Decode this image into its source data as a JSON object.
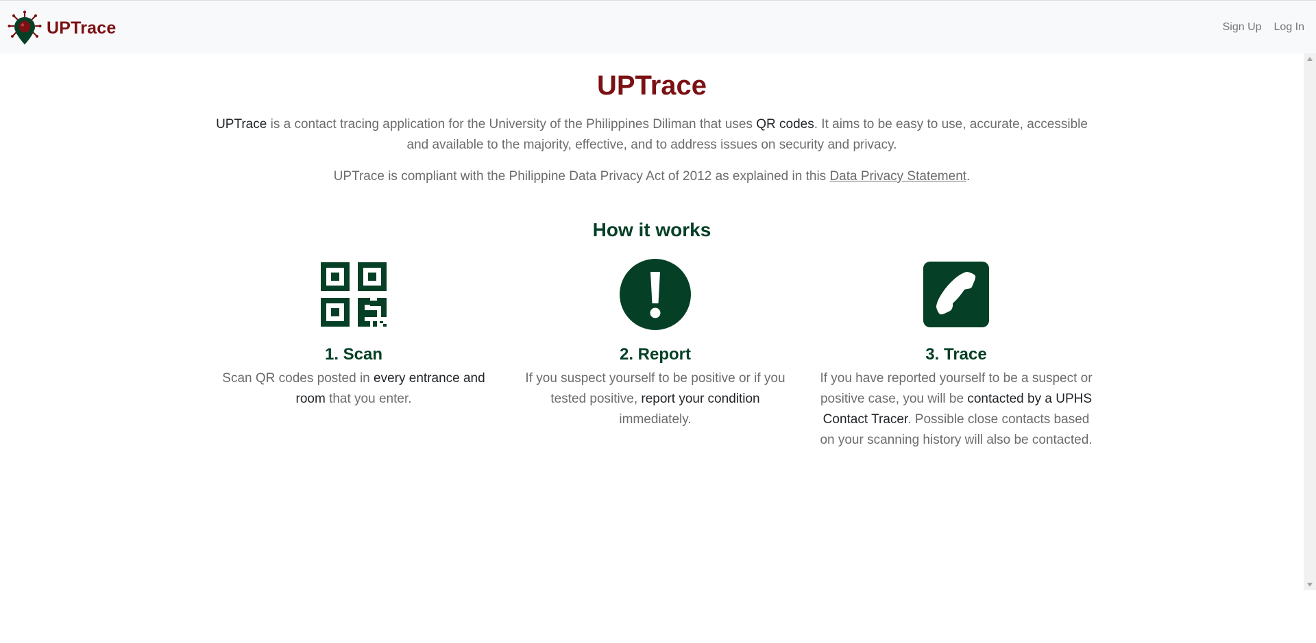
{
  "colors": {
    "brand_maroon": "#7b1113",
    "brand_green": "#054026",
    "muted_text": "#6c6c6c"
  },
  "navbar": {
    "brand": "UPTrace",
    "logo_icon": "location-pin-virus-icon",
    "links": [
      {
        "label": "Sign Up"
      },
      {
        "label": "Log In"
      }
    ]
  },
  "main": {
    "title": "UPTrace",
    "intro": {
      "app_name": "UPTrace",
      "text_a": " is a contact tracing application for the University of the Philippines Diliman that uses ",
      "qr": "QR codes",
      "text_b": ". It aims to be easy to use, accurate, accessible and available to the majority, effective, and to address issues on security and privacy."
    },
    "privacy": {
      "text": "UPTrace is compliant with the Philippine Data Privacy Act of 2012 as explained in this ",
      "link_label": "Data Privacy Statement",
      "end": "."
    },
    "how_it_works": {
      "heading": "How it works",
      "steps": [
        {
          "icon": "qr-code-icon",
          "title": "1. Scan",
          "desc_a": "Scan QR codes posted in ",
          "desc_strong": "every entrance and room",
          "desc_b": " that you enter."
        },
        {
          "icon": "exclamation-circle-icon",
          "title": "2. Report",
          "desc_a": "If you suspect yourself to be positive or if you tested positive, ",
          "desc_strong": "report your condition",
          "desc_b": " immediately."
        },
        {
          "icon": "phone-square-icon",
          "title": "3. Trace",
          "desc_a": "If you have reported yourself to be a suspect or positive case, you will be ",
          "desc_strong": "contacted by a UPHS Contact Tracer",
          "desc_b": ". Possible close contacts based on your scanning history will also be contacted."
        }
      ]
    }
  }
}
